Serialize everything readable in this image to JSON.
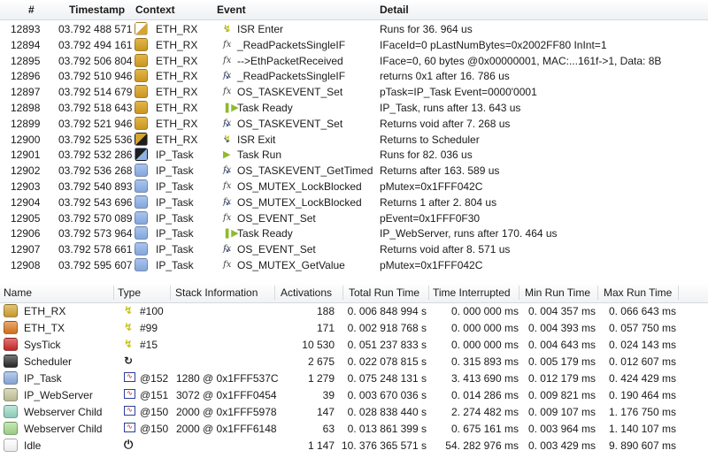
{
  "event_table": {
    "headers": {
      "num": "#",
      "timestamp": "Timestamp",
      "context": "Context",
      "event": "Event",
      "detail": "Detail"
    },
    "rows": [
      {
        "num": "12893",
        "timestamp": "03.792 488 571",
        "context": "ETH_RX",
        "context_icon": "isr-enter-context-icon",
        "event_icon": "isr-enter-icon",
        "event": "ISR Enter",
        "detail": "Runs for 36. 964 us"
      },
      {
        "num": "12894",
        "timestamp": "03.792 494 161",
        "context": "ETH_RX",
        "context_icon": "ethrx-context-icon",
        "event_icon": "function-call-icon",
        "event": "_ReadPacketsSingleIF",
        "detail": "IFaceId=0 pLastNumBytes=0x2002FF80 InInt=1"
      },
      {
        "num": "12895",
        "timestamp": "03.792 506 804",
        "context": "ETH_RX",
        "context_icon": "ethrx-context-icon",
        "event_icon": "function-call-icon",
        "event": "-->EthPacketReceived",
        "detail": "IFace=0, 60 bytes @0x00000001, MAC:...161f->1, Data: 8B"
      },
      {
        "num": "12896",
        "timestamp": "03.792 510 946",
        "context": "ETH_RX",
        "context_icon": "ethrx-context-icon",
        "event_icon": "function-return-icon",
        "event": "_ReadPacketsSingleIF",
        "detail": "returns 0x1 after 16. 786 us"
      },
      {
        "num": "12897",
        "timestamp": "03.792 514 679",
        "context": "ETH_RX",
        "context_icon": "ethrx-context-icon",
        "event_icon": "function-call-icon",
        "event": "OS_TASKEVENT_Set",
        "detail": "pTask=IP_Task Event=0000'0001"
      },
      {
        "num": "12898",
        "timestamp": "03.792 518 643",
        "context": "ETH_RX",
        "context_icon": "ethrx-context-icon",
        "event_icon": "task-ready-icon",
        "event": "Task Ready",
        "detail": "IP_Task, runs after 13. 643 us"
      },
      {
        "num": "12899",
        "timestamp": "03.792 521 946",
        "context": "ETH_RX",
        "context_icon": "ethrx-context-icon",
        "event_icon": "function-return-icon",
        "event": "OS_TASKEVENT_Set",
        "detail": "Returns void after 7. 268 us"
      },
      {
        "num": "12900",
        "timestamp": "03.792 525 536",
        "context": "ETH_RX",
        "context_icon": "isr-exit-context-icon",
        "event_icon": "isr-exit-icon",
        "event": "ISR Exit",
        "detail": "Returns to Scheduler"
      },
      {
        "num": "12901",
        "timestamp": "03.792 532 286",
        "context": "IP_Task",
        "context_icon": "task-run-context-icon",
        "event_icon": "task-run-icon",
        "event": "Task Run",
        "detail": "Runs for 82. 036 us"
      },
      {
        "num": "12902",
        "timestamp": "03.792 536 268",
        "context": "IP_Task",
        "context_icon": "iptask-context-icon",
        "event_icon": "function-return-icon",
        "event": "OS_TASKEVENT_GetTimed",
        "detail": "Returns  after 163. 589 us"
      },
      {
        "num": "12903",
        "timestamp": "03.792 540 893",
        "context": "IP_Task",
        "context_icon": "iptask-context-icon",
        "event_icon": "function-call-icon",
        "event": "OS_MUTEX_LockBlocked",
        "detail": "pMutex=0x1FFF042C"
      },
      {
        "num": "12904",
        "timestamp": "03.792 543 696",
        "context": "IP_Task",
        "context_icon": "iptask-context-icon",
        "event_icon": "function-return-icon",
        "event": "OS_MUTEX_LockBlocked",
        "detail": "Returns 1 after 2. 804 us"
      },
      {
        "num": "12905",
        "timestamp": "03.792 570 089",
        "context": "IP_Task",
        "context_icon": "iptask-context-icon",
        "event_icon": "function-call-icon",
        "event": "OS_EVENT_Set",
        "detail": "pEvent=0x1FFF0F30"
      },
      {
        "num": "12906",
        "timestamp": "03.792 573 964",
        "context": "IP_Task",
        "context_icon": "iptask-context-icon",
        "event_icon": "task-ready-icon",
        "event": "Task Ready",
        "detail": "IP_WebServer, runs after 170. 464 us"
      },
      {
        "num": "12907",
        "timestamp": "03.792 578 661",
        "context": "IP_Task",
        "context_icon": "iptask-context-icon",
        "event_icon": "function-return-icon",
        "event": "OS_EVENT_Set",
        "detail": "Returns void after 8. 571 us"
      },
      {
        "num": "12908",
        "timestamp": "03.792 595 607",
        "context": "IP_Task",
        "context_icon": "iptask-context-icon",
        "event_icon": "function-call-icon",
        "event": "OS_MUTEX_GetValue",
        "detail": "pMutex=0x1FFF042C"
      }
    ]
  },
  "context_table": {
    "headers": {
      "name": "Name",
      "type": "Type",
      "stack": "Stack Information",
      "activations": "Activations",
      "total": "Total Run Time",
      "interrupted": "Time Interrupted",
      "min": "Min Run Time",
      "max": "Max Run Time"
    },
    "rows": [
      {
        "name": "ETH_RX",
        "color": "#d4a530",
        "type_icon": "interrupt-icon",
        "prio": "#100",
        "stack": "",
        "activations": "188",
        "total": "0. 006 848 994 s",
        "interrupted": "0. 000 000 ms",
        "min": "0. 004 357 ms",
        "max": "0. 066 643 ms"
      },
      {
        "name": "ETH_TX",
        "color": "#e07a1f",
        "type_icon": "interrupt-icon",
        "prio": "#99",
        "stack": "",
        "activations": "171",
        "total": "0. 002 918 768 s",
        "interrupted": "0. 000 000 ms",
        "min": "0. 004 393 ms",
        "max": "0. 057 750 ms"
      },
      {
        "name": "SysTick",
        "color": "#d32a2a",
        "type_icon": "interrupt-icon",
        "prio": "#15",
        "stack": "",
        "activations": "10 530",
        "total": "0. 051 237 833 s",
        "interrupted": "0. 000 000 ms",
        "min": "0. 004 643 ms",
        "max": "0. 024 143 ms"
      },
      {
        "name": "Scheduler",
        "color": "#2b2b2b",
        "type_icon": "scheduler-icon",
        "prio": "",
        "stack": "",
        "activations": "2 675",
        "total": "0. 022 078 815 s",
        "interrupted": "0. 315 893 ms",
        "min": "0. 005 179 ms",
        "max": "0. 012 607 ms"
      },
      {
        "name": "IP_Task",
        "color": "#8fb1e3",
        "type_icon": "task-icon",
        "prio": "@152",
        "stack": "1280 @ 0x1FFF537C",
        "activations": "1 279",
        "total": "0. 075 248 131 s",
        "interrupted": "3. 413 690 ms",
        "min": "0. 012 179 ms",
        "max": "0. 424 429 ms"
      },
      {
        "name": "IP_WebServer",
        "color": "#c8c89e",
        "type_icon": "task-icon",
        "prio": "@151",
        "stack": "3072 @ 0x1FFF0454",
        "activations": "39",
        "total": "0. 003 670 036 s",
        "interrupted": "0. 014 286 ms",
        "min": "0. 009 821 ms",
        "max": "0. 190 464 ms"
      },
      {
        "name": "Webserver Child",
        "color": "#98dcc4",
        "type_icon": "task-icon",
        "prio": "@150",
        "stack": "2000 @ 0x1FFF5978",
        "activations": "147",
        "total": "0. 028 838 440 s",
        "interrupted": "2. 274 482 ms",
        "min": "0. 009 107 ms",
        "max": "1. 176 750 ms"
      },
      {
        "name": "Webserver Child",
        "color": "#a6dd8e",
        "type_icon": "task-icon",
        "prio": "@150",
        "stack": "2000 @ 0x1FFF6148",
        "activations": "63",
        "total": "0. 013 861 399 s",
        "interrupted": "0. 675 161 ms",
        "min": "0. 003 964 ms",
        "max": "1. 140 107 ms"
      },
      {
        "name": "Idle",
        "color": "#ffffff",
        "type_icon": "idle-power-icon",
        "prio": "",
        "stack": "",
        "activations": "1 147",
        "total": "10. 376 365 571 s",
        "interrupted": "54. 282 976 ms",
        "min": "0. 003 429 ms",
        "max": "9. 890 607 ms"
      }
    ]
  }
}
